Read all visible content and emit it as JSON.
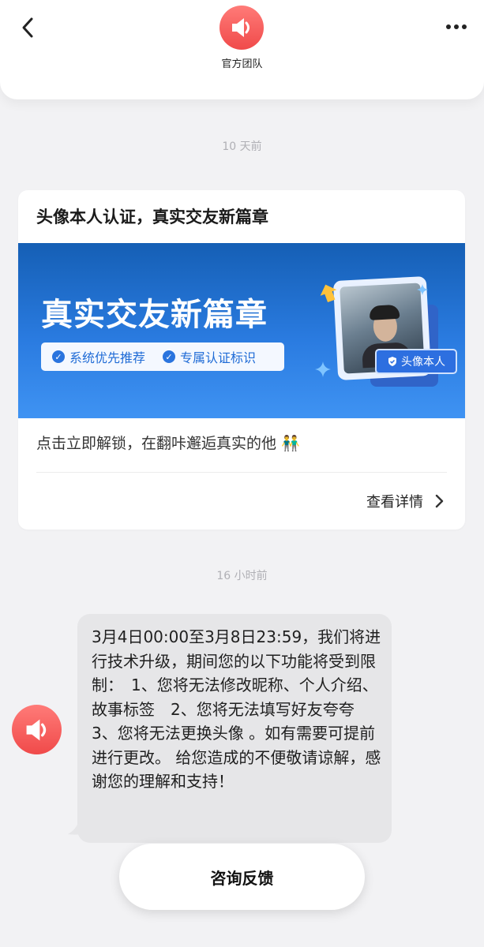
{
  "header": {
    "title": "官方团队",
    "back_icon": "chevron-left-icon",
    "more_icon": "more-dots-icon",
    "avatar_icon": "speaker-icon",
    "avatar_color": "#f04a4a"
  },
  "timestamps": [
    "10 天前",
    "16 小时前"
  ],
  "card": {
    "title": "头像本人认证，真实交友新篇章",
    "banner": {
      "headline": "真实交友新篇章",
      "features": [
        "系统优先推荐",
        "专属认证标识"
      ],
      "tag": "头像本人",
      "background": "#2a7be0"
    },
    "text": "点击立即解锁，在翻咔邂逅真实的他",
    "emoji": "👬",
    "detail_label": "查看详情"
  },
  "message": {
    "text": "3月4日00:00至3月8日23:59，我们将进行技术升级，期间您的以下功能将受到限制：　1、您将无法修改昵称、个人介绍、故事标签　2、您将无法填写好友夸夸　3、您将无法更换头像 。如有需要可提前进行更改。 给您造成的不便敬请谅解，感谢您的理解和支持！",
    "avatar_icon": "speaker-icon"
  },
  "feedback_button": "咨询反馈"
}
